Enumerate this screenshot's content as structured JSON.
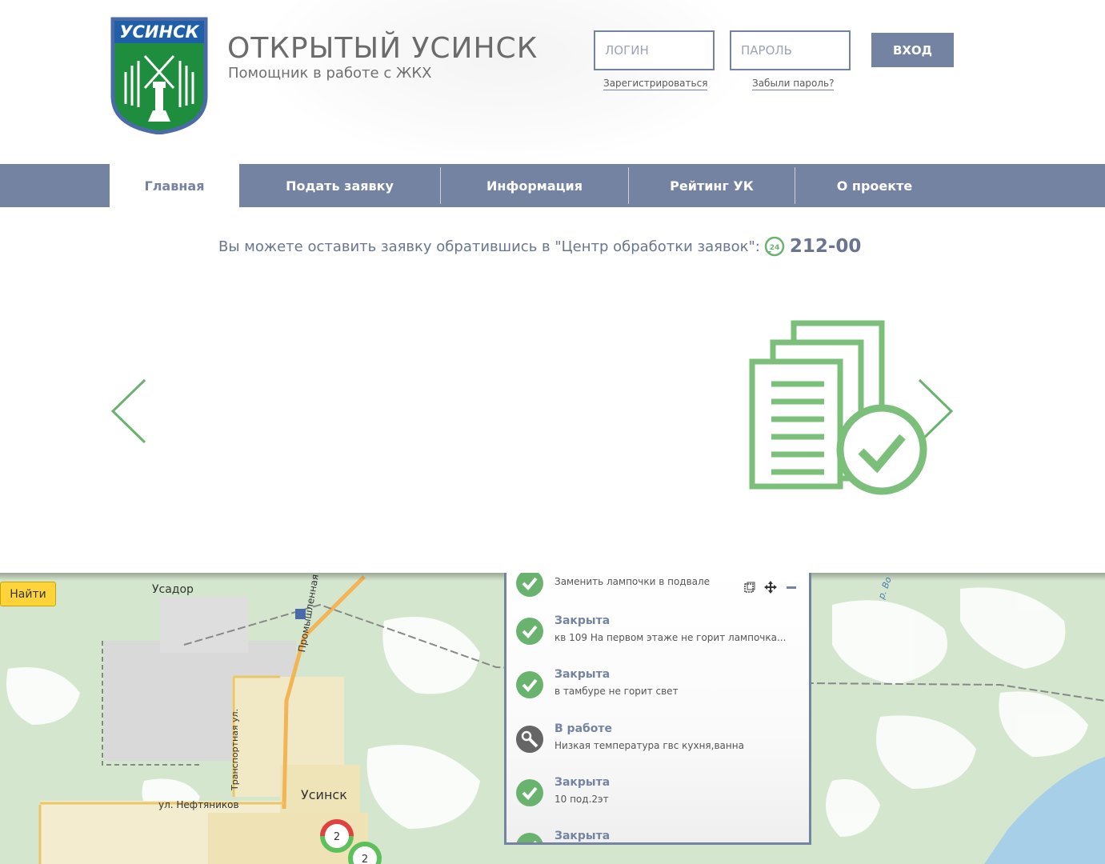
{
  "header": {
    "logo_text": "УСИНСК",
    "title": "ОТКРЫТЫЙ УСИНСК",
    "subtitle": "Помощник в работе с ЖКХ"
  },
  "auth": {
    "login_placeholder": "ЛОГИН",
    "password_placeholder": "ПАРОЛЬ",
    "login_button": "ВХОД",
    "register_link": "Зарегистрироваться",
    "forgot_link": "Забыли пароль?"
  },
  "nav": {
    "items": [
      {
        "label": "Главная",
        "active": true
      },
      {
        "label": "Подать заявку",
        "active": false
      },
      {
        "label": "Информация",
        "active": false
      },
      {
        "label": "Рейтинг УК",
        "active": false
      },
      {
        "label": "О проекте",
        "active": false
      }
    ]
  },
  "callcenter": {
    "text": "Вы можете оставить заявку обратившись в \"Центр обработки заявок\":",
    "icon_label": "24",
    "phone": "212-00"
  },
  "slider": {
    "prev_icon": "chevron-left-icon",
    "next_icon": "chevron-right-icon",
    "slide_icon": "documents-check-icon"
  },
  "map": {
    "find_button": "Найти",
    "labels": {
      "usador": "Усадор",
      "promyshlennaya": "Промышленная ул.",
      "transportnaya": "Транспортная ул.",
      "neftyanikov": "ул. Нефтяников",
      "usinsk": "Усинск",
      "river": "р. Во"
    },
    "clusters": [
      {
        "count": "2",
        "status": "mixed"
      },
      {
        "count": "2",
        "status": "ok"
      }
    ]
  },
  "requests": {
    "tools": [
      "selection-icon",
      "move-icon",
      "minimize-icon"
    ],
    "items": [
      {
        "status": "",
        "text": "Заменить лампочки в подвале",
        "type": "ok"
      },
      {
        "status": "Закрыта",
        "text": "кв 109 На первом этаже не горит лампочка...",
        "type": "ok"
      },
      {
        "status": "Закрыта",
        "text": "в тамбуре не горит свет",
        "type": "ok"
      },
      {
        "status": "В работе",
        "text": "Низкая температура гвс кухня,ванна",
        "type": "work"
      },
      {
        "status": "Закрыта",
        "text": "10 под.2эт",
        "type": "ok"
      },
      {
        "status": "Закрыта",
        "text": "",
        "type": "ok"
      }
    ]
  },
  "colors": {
    "accent": "#7583a3",
    "green": "#6ab36f",
    "find_button": "#ffd43a"
  }
}
